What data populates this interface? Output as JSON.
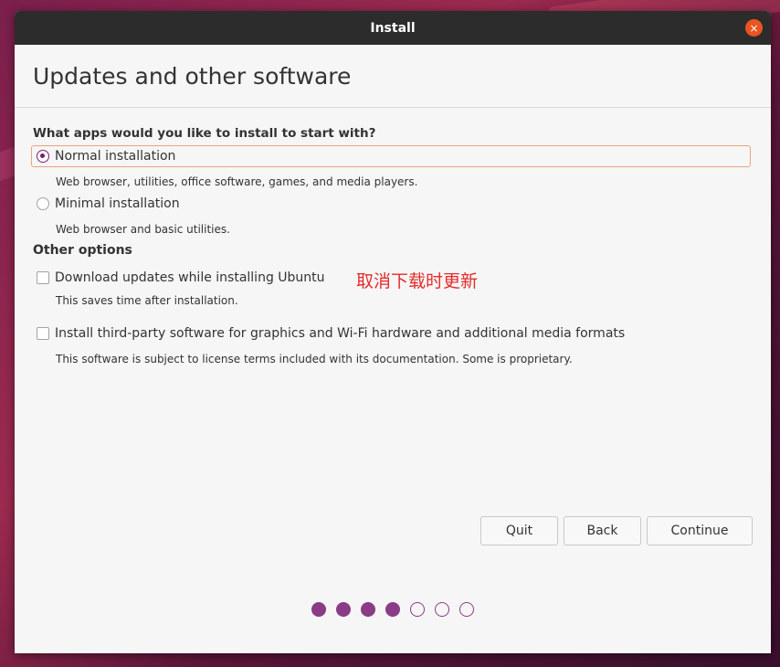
{
  "window": {
    "title": "Install",
    "close_icon": "×"
  },
  "page": {
    "title": "Updates and other software"
  },
  "install_type": {
    "question": "What apps would you like to install to start with?",
    "options": [
      {
        "label": "Normal installation",
        "description": "Web browser, utilities, office software, games, and media players.",
        "selected": true
      },
      {
        "label": "Minimal installation",
        "description": "Web browser and basic utilities.",
        "selected": false
      }
    ]
  },
  "other_options": {
    "heading": "Other options",
    "items": [
      {
        "label": "Download updates while installing Ubuntu",
        "description": "This saves time after installation.",
        "checked": false
      },
      {
        "label": "Install third-party software for graphics and Wi-Fi hardware and additional media formats",
        "description": "This software is subject to license terms included with its documentation. Some is proprietary.",
        "checked": false
      }
    ]
  },
  "annotation": "取消下载时更新",
  "buttons": {
    "quit": "Quit",
    "back": "Back",
    "continue": "Continue"
  },
  "progress": {
    "total_steps": 7,
    "completed_steps": 4
  },
  "colors": {
    "accent": "#77216f",
    "close": "#e95420",
    "annotation": "#e52a2a",
    "focus": "#e9a37f"
  }
}
